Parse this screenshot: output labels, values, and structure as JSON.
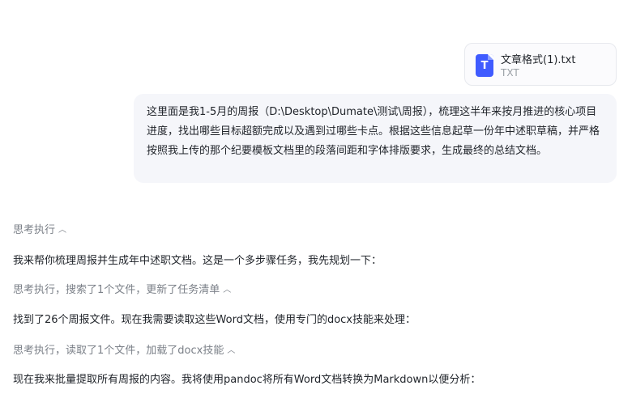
{
  "attachment": {
    "file_name": "文章格式(1).txt",
    "file_type": "TXT",
    "icon_letter": "T",
    "icon_color": "#3f5bff"
  },
  "user_message": {
    "text": "这里面是我1-5月的周报（D:\\Desktop\\Dumate\\测试\\周报），梳理这半年来按月推进的核心项目进度，找出哪些目标超额完成以及遇到过哪些卡点。根据这些信息起草一份年中述职草稿，并严格按照我上传的那个纪要模板文档里的段落间距和字体排版要求，生成最终的总结文档。"
  },
  "conversation": [
    {
      "kind": "thinking",
      "label": "思考执行",
      "icon": "chevron-up-icon"
    },
    {
      "kind": "reply",
      "text": "我来帮你梳理周报并生成年中述职文档。这是一个多步骤任务，我先规划一下："
    },
    {
      "kind": "thinking",
      "label": "思考执行，搜索了1个文件，更新了任务清单",
      "icon": "chevron-up-icon"
    },
    {
      "kind": "reply",
      "text": "找到了26个周报文件。现在我需要读取这些Word文档，使用专门的docx技能来处理："
    },
    {
      "kind": "thinking",
      "label": "思考执行，读取了1个文件，加载了docx技能",
      "icon": "chevron-up-icon"
    },
    {
      "kind": "reply",
      "text": "现在我来批量提取所有周报的内容。我将使用pandoc将所有Word文档转换为Markdown以便分析："
    }
  ]
}
